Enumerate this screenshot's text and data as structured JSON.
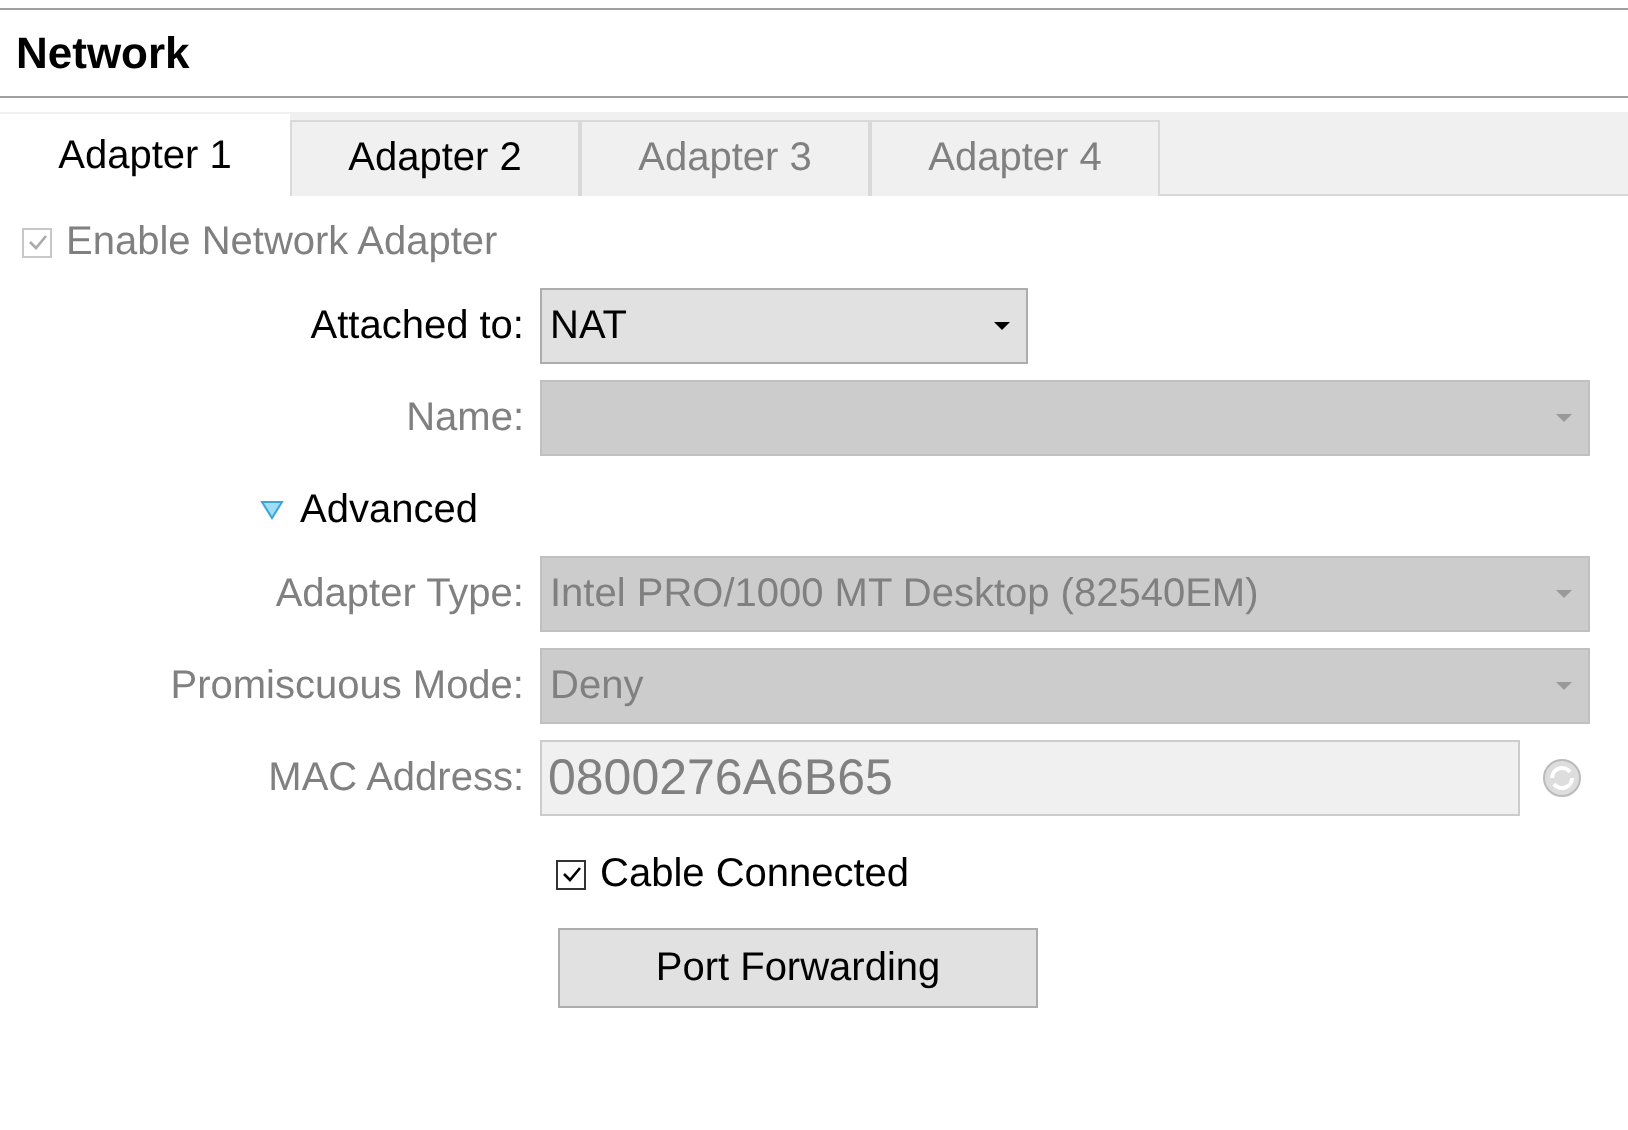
{
  "title": "Network",
  "tabs": [
    {
      "label": "Adapter 1",
      "selected": true,
      "disabled": false
    },
    {
      "label": "Adapter 2",
      "selected": false,
      "disabled": false
    },
    {
      "label": "Adapter 3",
      "selected": false,
      "disabled": true
    },
    {
      "label": "Adapter 4",
      "selected": false,
      "disabled": true
    }
  ],
  "enable_adapter": {
    "label": "Enable Network Adapter",
    "checked": true,
    "disabled": true
  },
  "rows": [
    {
      "kind": "dropdown",
      "label": "Attached to:",
      "value": "NAT",
      "disabled": false
    },
    {
      "kind": "combo",
      "label": "Name:",
      "disabled": true
    },
    {
      "kind": "section",
      "label": "Advanced",
      "expanded": true
    },
    {
      "kind": "combo",
      "label": "Adapter Type:",
      "value": "Intel PRO/1000 MT Desktop (82540EM)",
      "disabled": true
    },
    {
      "kind": "combo",
      "label": "Promiscuous Mode:",
      "value": "Deny",
      "disabled": true
    },
    {
      "kind": "text",
      "label": "MAC Address:",
      "value": "0800276A6B65",
      "disabled": true
    },
    {
      "kind": "checkbox",
      "label": "Cable Connected",
      "checked": true
    },
    {
      "kind": "button",
      "label": "Port Forwarding"
    }
  ]
}
